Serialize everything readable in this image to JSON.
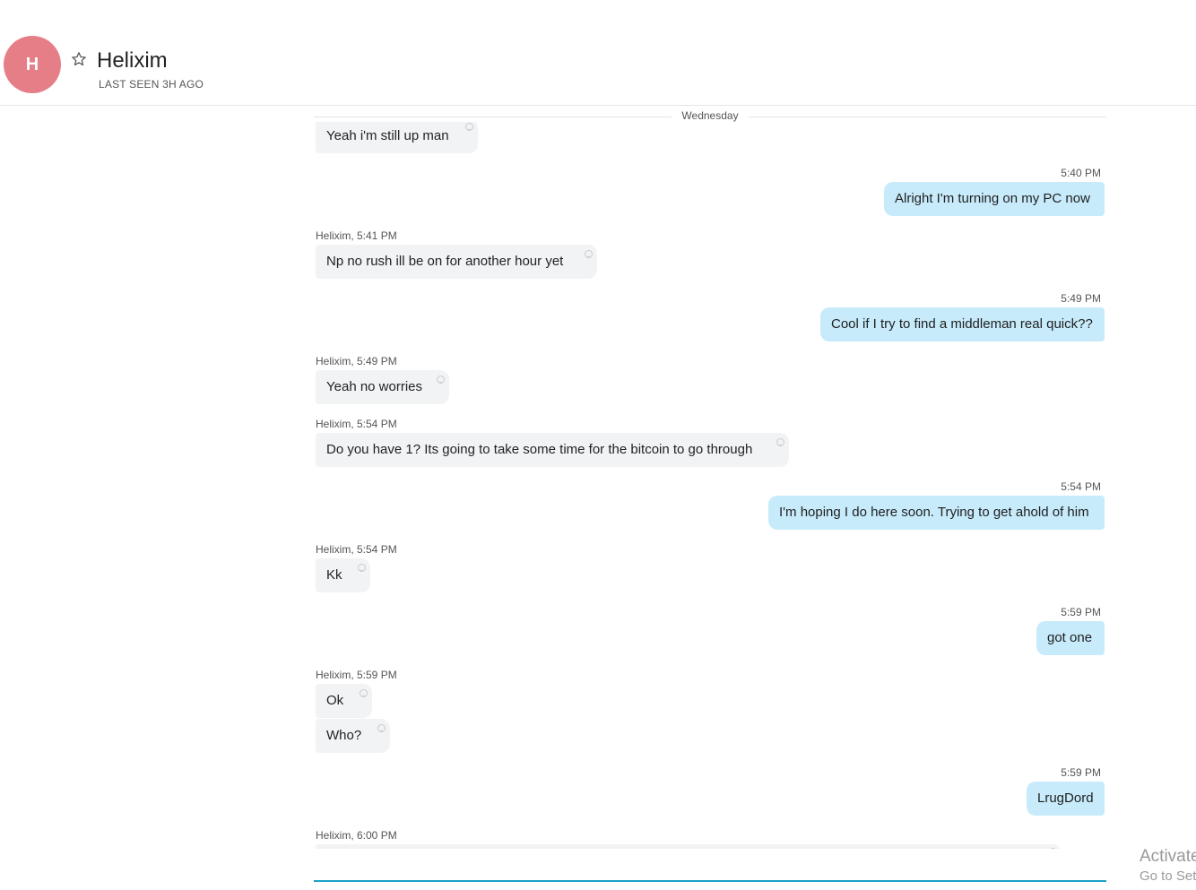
{
  "contact": {
    "initial": "H",
    "name": "Helixim",
    "last_seen": "LAST SEEN 3H AGO",
    "avatar_color": "#e57e86"
  },
  "date_divider": "Wednesday",
  "messages": [
    {
      "dir": "in",
      "meta": "",
      "text": "Yeah i'm still up man"
    },
    {
      "dir": "out",
      "meta": "5:40 PM",
      "text": "Alright I'm turning on my PC now"
    },
    {
      "dir": "in",
      "meta": "Helixim, 5:41 PM",
      "text": "Np no rush ill be on for another hour yet"
    },
    {
      "dir": "out",
      "meta": "5:49 PM",
      "text": "Cool if I try to find a middleman real quick??"
    },
    {
      "dir": "in",
      "meta": "Helixim, 5:49 PM",
      "text": "Yeah no worries"
    },
    {
      "dir": "in",
      "meta": "Helixim, 5:54 PM",
      "text": "Do you have 1? Its going to take some time for the bitcoin to go through"
    },
    {
      "dir": "out",
      "meta": "5:54 PM",
      "text": "I'm hoping I do here soon. Trying to get ahold of him"
    },
    {
      "dir": "in",
      "meta": "Helixim, 5:54 PM",
      "text": "Kk"
    },
    {
      "dir": "out",
      "meta": "5:59 PM",
      "text": "got one"
    },
    {
      "dir": "in",
      "meta": "Helixim, 5:59 PM",
      "text": "Ok"
    },
    {
      "dir": "in",
      "meta": "",
      "text": "Who?"
    },
    {
      "dir": "out",
      "meta": "5:59 PM",
      "text": "LrugDord"
    },
    {
      "dir": "in",
      "meta": "Helixim, 6:00 PM",
      "text": ""
    }
  ],
  "watermark": {
    "line1": "Activate",
    "line2": "Go to Set"
  },
  "colors": {
    "incoming_bubble": "#f1f3f5",
    "outgoing_bubble": "#c7ebfb",
    "accent_line": "#1aa0c4"
  }
}
